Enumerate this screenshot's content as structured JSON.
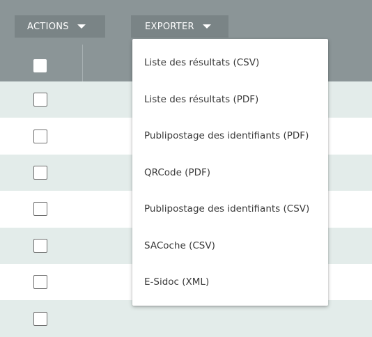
{
  "toolbar": {
    "actions_label": "ACTIONS",
    "export_label": "EXPORTER"
  },
  "table": {
    "row_count": 7,
    "checked": [
      false,
      false,
      false,
      false,
      false,
      false,
      false
    ]
  },
  "export_menu": {
    "items": [
      {
        "label": "Liste des résultats (CSV)"
      },
      {
        "label": "Liste des résultats (PDF)"
      },
      {
        "label": "Publipostage des identifiants (PDF)"
      },
      {
        "label": "QRCode (PDF)"
      },
      {
        "label": "Publipostage des identifiants (CSV)"
      },
      {
        "label": "SACoche (CSV)"
      },
      {
        "label": "E-Sidoc (XML)"
      }
    ]
  },
  "colors": {
    "toolbar_bg": "#8b9597",
    "button_bg": "#7a8486",
    "row_alt_bg": "#e3ecea",
    "menu_text": "#3a3a3a"
  }
}
